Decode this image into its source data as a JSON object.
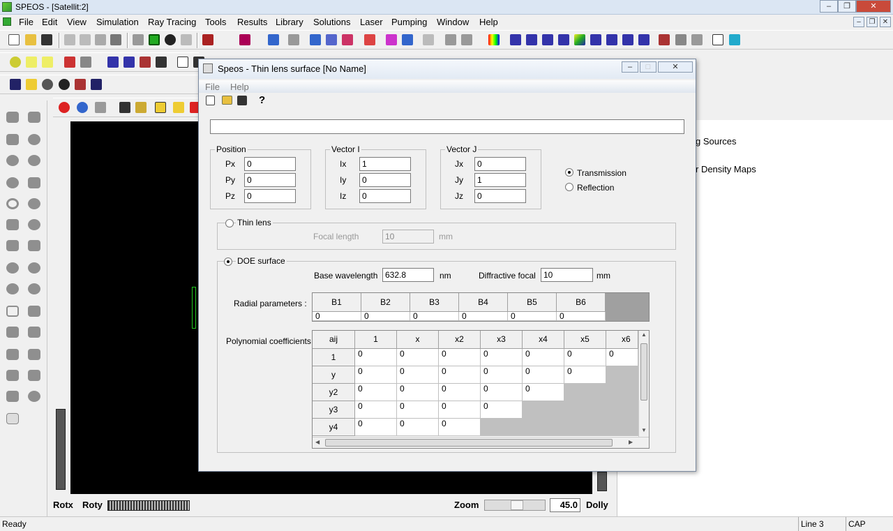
{
  "app": {
    "title": "SPEOS - [Satellit:2]"
  },
  "menu": [
    "File",
    "Edit",
    "View",
    "Simulation",
    "Ray Tracing",
    "Tools",
    "Results",
    "Library",
    "Solutions",
    "Laser",
    "Pumping",
    "Window",
    "Help"
  ],
  "right_panel": {
    "items": [
      "g Sources",
      "r Density Maps"
    ]
  },
  "viewport": {
    "rotx": "Rotx",
    "roty": "Roty",
    "zoom": "Zoom",
    "zoom_value": "45.0",
    "dolly": "Dolly"
  },
  "status": {
    "ready": "Ready",
    "line": "Line 3",
    "cap": "CAP"
  },
  "dialog": {
    "title": "Speos - Thin lens surface [No Name]",
    "menu": [
      "File",
      "Help"
    ],
    "name_value": "",
    "position": {
      "legend": "Position",
      "labels": [
        "Px",
        "Py",
        "Pz"
      ],
      "values": [
        "0",
        "0",
        "0"
      ]
    },
    "vector_i": {
      "legend": "Vector I",
      "labels": [
        "Ix",
        "Iy",
        "Iz"
      ],
      "values": [
        "1",
        "0",
        "0"
      ]
    },
    "vector_j": {
      "legend": "Vector J",
      "labels": [
        "Jx",
        "Jy",
        "Jz"
      ],
      "values": [
        "0",
        "1",
        "0"
      ]
    },
    "mode": {
      "transmission": "Transmission",
      "reflection": "Reflection",
      "selected": "Transmission"
    },
    "thin_lens": {
      "label": "Thin lens",
      "focal_label": "Focal length",
      "focal_value": "10",
      "unit": "mm"
    },
    "doe": {
      "label": "DOE surface",
      "wavelength_label": "Base wavelength",
      "wavelength_value": "632.8",
      "wavelength_unit": "nm",
      "focal_label": "Diffractive focal",
      "focal_value": "10",
      "focal_unit": "mm"
    },
    "radial": {
      "label": "Radial parameters :",
      "headers": [
        "B1",
        "B2",
        "B3",
        "B4",
        "B5",
        "B6"
      ],
      "values": [
        "0",
        "0",
        "0",
        "0",
        "0",
        "0"
      ]
    },
    "poly": {
      "label": "Polynomial coefficients :",
      "corner": "aij",
      "cols": [
        "1",
        "x",
        "x2",
        "x3",
        "x4",
        "x5",
        "x6"
      ],
      "rows": [
        {
          "name": "1",
          "values": [
            "0",
            "0",
            "0",
            "0",
            "0",
            "0",
            "0"
          ]
        },
        {
          "name": "y",
          "values": [
            "0",
            "0",
            "0",
            "0",
            "0",
            "0"
          ]
        },
        {
          "name": "y2",
          "values": [
            "0",
            "0",
            "0",
            "0",
            "0"
          ]
        },
        {
          "name": "y3",
          "values": [
            "0",
            "0",
            "0",
            "0"
          ]
        },
        {
          "name": "y4",
          "values": [
            "0",
            "0",
            "0"
          ]
        }
      ]
    }
  }
}
